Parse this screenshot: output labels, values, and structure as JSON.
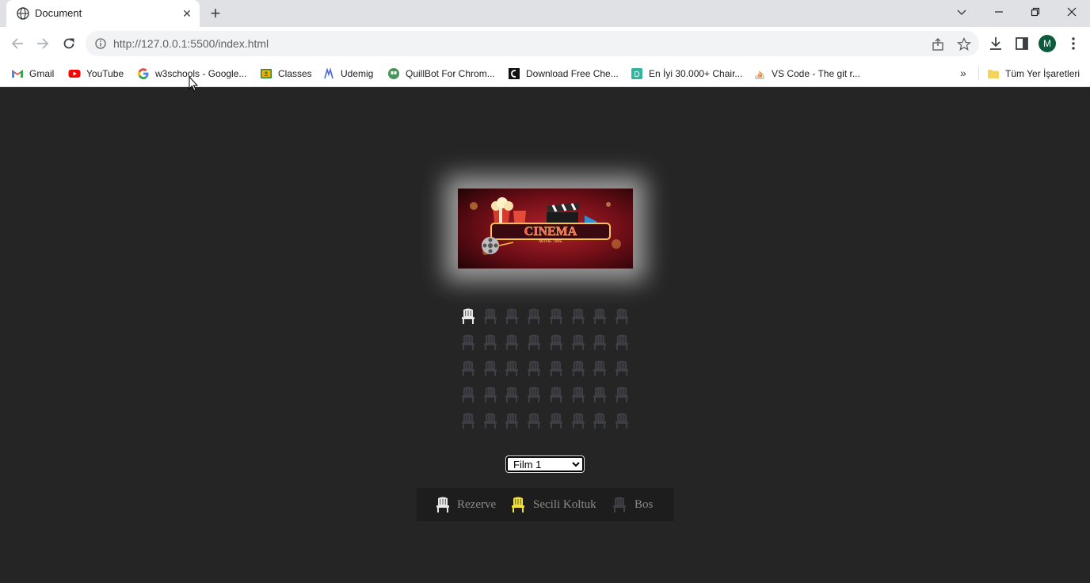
{
  "browser": {
    "tab": {
      "title": "Document",
      "favicon": "globe-icon"
    },
    "url": "http://127.0.0.1:5500/index.html",
    "profile_initial": "M",
    "bookmarks": [
      {
        "label": "Gmail",
        "icon": "gmail-icon"
      },
      {
        "label": "YouTube",
        "icon": "youtube-icon"
      },
      {
        "label": "w3schools - Google...",
        "icon": "google-icon"
      },
      {
        "label": "Classes",
        "icon": "classroom-icon"
      },
      {
        "label": "Udemig",
        "icon": "udemig-icon"
      },
      {
        "label": "QuillBot For Chrom...",
        "icon": "quillbot-icon"
      },
      {
        "label": "Download Free Che...",
        "icon": "chevrolet-icon"
      },
      {
        "label": "En İyi 30.000+ Chair...",
        "icon": "dribbble-icon"
      },
      {
        "label": "VS Code - The git r...",
        "icon": "stackoverflow-icon"
      }
    ],
    "all_bookmarks_label": "Tüm Yer İşaretleri"
  },
  "page": {
    "poster": {
      "image": "cinema-poster",
      "title": "CINEMA",
      "subtitle": "MOVIE TIME"
    },
    "seats": {
      "rows": [
        [
          "reserved",
          "empty",
          "empty",
          "empty",
          "empty",
          "empty",
          "empty",
          "empty"
        ],
        [
          "empty",
          "empty",
          "empty",
          "empty",
          "empty",
          "empty",
          "empty",
          "empty"
        ],
        [
          "empty",
          "empty",
          "empty",
          "empty",
          "empty",
          "empty",
          "empty",
          "empty"
        ],
        [
          "empty",
          "empty",
          "empty",
          "empty",
          "empty",
          "empty",
          "empty",
          "empty"
        ],
        [
          "empty",
          "empty",
          "empty",
          "empty",
          "empty",
          "empty",
          "empty",
          "empty"
        ]
      ]
    },
    "movie_select": {
      "selected": "Film 1"
    },
    "legend": [
      {
        "status": "reserved",
        "label": "Rezerve"
      },
      {
        "status": "selected",
        "label": "Secili Koltuk"
      },
      {
        "status": "empty",
        "label": "Bos"
      }
    ],
    "colors": {
      "background": "#252525",
      "seat_reserved": "#e8e8e8",
      "seat_selected": "#f2e23a",
      "seat_empty": "#3e3e45",
      "legend_bg": "#1d1d1d"
    }
  }
}
